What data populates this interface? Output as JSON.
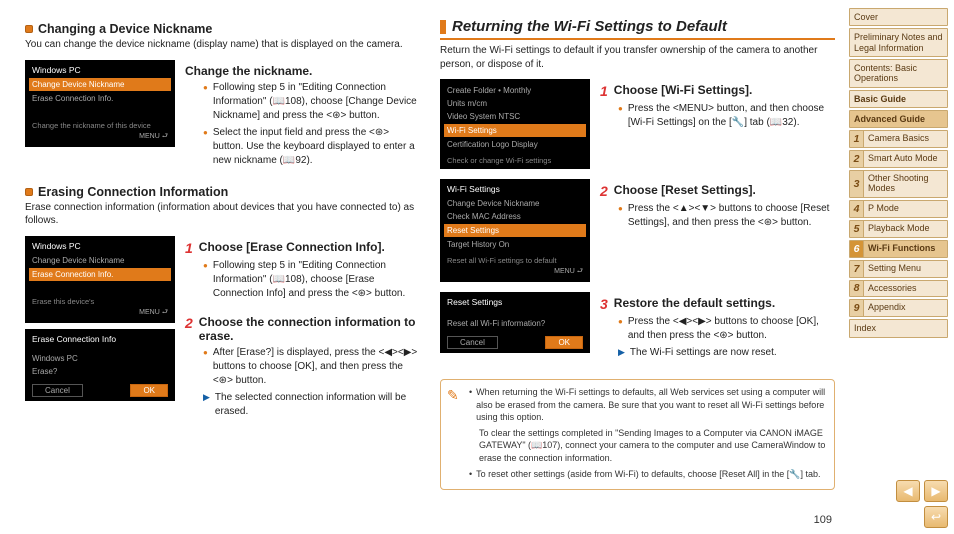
{
  "page_number": "109",
  "col1": {
    "sec1": {
      "title": "Changing a Device Nickname",
      "intro": "You can change the device nickname (display name) that is displayed on the camera.",
      "screen": {
        "title": "Windows PC",
        "hl": "Change Device Nickname",
        "line2": "Erase Connection Info.",
        "foot": "Change the nickname of this device",
        "menu": "MENU ⮐"
      },
      "step_title": "Change the nickname.",
      "bullets": [
        "Following step 5 in \"Editing Connection Information\" (📖108), choose [Change Device Nickname] and press the <⊛> button.",
        "Select the input field and press the <⊛> button. Use the keyboard displayed to enter a new nickname (📖92)."
      ]
    },
    "sec2": {
      "title": "Erasing Connection Information",
      "intro": "Erase connection information (information about devices that you have connected to) as follows.",
      "screen1": {
        "title": "Windows PC",
        "line1": "Change Device Nickname",
        "hl": "Erase Connection Info.",
        "foot": "Erase this device's",
        "menu": "MENU ⮐"
      },
      "screen2": {
        "title": "Erase Connection Info",
        "line1": "Windows PC",
        "line2": "Erase?",
        "cancel": "Cancel",
        "ok": "OK"
      },
      "step1_title": "Choose [Erase Connection Info].",
      "step1_bullets": [
        "Following step 5 in \"Editing Connection Information\" (📖108), choose [Erase Connection Info] and press the <⊛> button."
      ],
      "step2_title": "Choose the connection information to erase.",
      "step2_bullets": [
        "After [Erase?] is displayed, press the <◀><▶> buttons to choose [OK], and then press the <⊛> button."
      ],
      "step2_arrow": "The selected connection information will be erased."
    }
  },
  "col2": {
    "h1": "Returning the Wi-Fi Settings to Default",
    "intro": "Return the Wi-Fi settings to default if you transfer ownership of the camera to another person, or dispose of it.",
    "screen1": {
      "lines": [
        "Create Folder   • Monthly",
        "Units            m/cm",
        "Video System   NTSC"
      ],
      "hl": "Wi-Fi Settings",
      "line5": "Certification Logo Display",
      "foot": "Check or change Wi-Fi settings"
    },
    "screen2": {
      "title": "Wi-Fi Settings",
      "lines": [
        "Change Device Nickname",
        "Check MAC Address"
      ],
      "hl": "Reset Settings",
      "line4": "Target History      On",
      "foot": "Reset all Wi-Fi settings to default",
      "menu": "MENU ⮐"
    },
    "screen3": {
      "title": "Reset Settings",
      "line1": "Reset all Wi-Fi information?",
      "cancel": "Cancel",
      "ok": "OK"
    },
    "step1_title": "Choose [Wi-Fi Settings].",
    "step1_bullets": [
      "Press the <MENU> button, and then choose [Wi-Fi Settings] on the [🔧] tab (📖32)."
    ],
    "step2_title": "Choose [Reset Settings].",
    "step2_bullets": [
      "Press the <▲><▼> buttons to choose [Reset Settings], and then press the <⊛> button."
    ],
    "step3_title": "Restore the default settings.",
    "step3_bullets": [
      "Press the <◀><▶> buttons to choose [OK], and then press the <⊛> button."
    ],
    "step3_arrow": "The Wi-Fi settings are now reset.",
    "note": [
      "When returning the Wi-Fi settings to defaults, all Web services set using a computer will also be erased from the camera. Be sure that you want to reset all Wi-Fi settings before using this option.",
      "To clear the settings completed in \"Sending Images to a Computer via CANON iMAGE GATEWAY\" (📖107), connect your camera to the computer and use CameraWindow to erase the connection information.",
      "To reset other settings (aside from Wi-Fi) to defaults, choose [Reset All] in the [🔧] tab."
    ]
  },
  "sidebar": {
    "top": [
      "Cover",
      "Preliminary Notes and Legal Information",
      "Contents: Basic Operations"
    ],
    "basic": "Basic Guide",
    "advanced": "Advanced Guide",
    "chapters": [
      {
        "n": "1",
        "t": "Camera Basics"
      },
      {
        "n": "2",
        "t": "Smart Auto Mode"
      },
      {
        "n": "3",
        "t": "Other Shooting Modes"
      },
      {
        "n": "4",
        "t": "P Mode"
      },
      {
        "n": "5",
        "t": "Playback Mode"
      },
      {
        "n": "6",
        "t": "Wi-Fi Functions"
      },
      {
        "n": "7",
        "t": "Setting Menu"
      },
      {
        "n": "8",
        "t": "Accessories"
      },
      {
        "n": "9",
        "t": "Appendix"
      }
    ],
    "index": "Index"
  }
}
